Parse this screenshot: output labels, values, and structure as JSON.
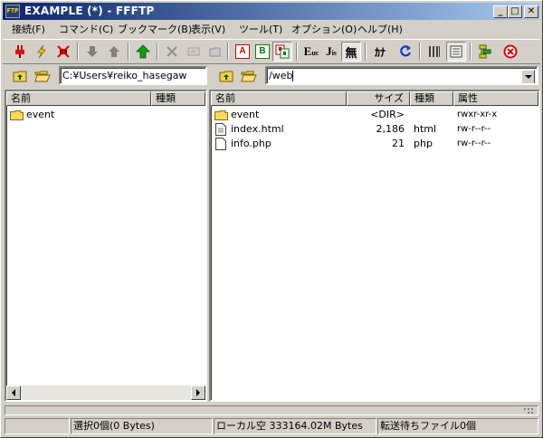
{
  "window": {
    "title": "EXAMPLE (*) - FFFTP"
  },
  "window_buttons": {
    "minimize": "_",
    "maximize": "□",
    "close": "✕"
  },
  "menu": [
    "接続(F)",
    "コマンド(C)",
    "ブックマーク(B)",
    "表示(V)",
    "ツール(T)",
    "オプション(O)",
    "ヘルプ(H)"
  ],
  "toolbar": {
    "ascii_mode": "A",
    "binary_mode": "B",
    "euc": "E",
    "euc_sub": "uc",
    "jis": "J",
    "jis_sub": "is",
    "no_convert": "無",
    "kana": "ｶﾅ"
  },
  "local": {
    "path": "C:¥Users¥reiko_hasegaw",
    "columns": {
      "name": "名前",
      "type": "種類"
    },
    "files": [
      {
        "name": "event",
        "icon": "folder-icon"
      }
    ]
  },
  "remote": {
    "path": "/web",
    "columns": {
      "name": "名前",
      "size": "サイズ",
      "type": "種類",
      "attr": "属性"
    },
    "files": [
      {
        "name": "event",
        "size": "<DIR>",
        "type": "",
        "attr": "rwxr-xr-x",
        "icon": "folder-icon"
      },
      {
        "name": "index.html",
        "size": "2,186",
        "type": "html",
        "attr": "rw-r--r--",
        "icon": "file-icon"
      },
      {
        "name": "info.php",
        "size": "21",
        "type": "php",
        "attr": "rw-r--r--",
        "icon": "file-icon"
      }
    ]
  },
  "status": {
    "selection": "選択0個(0 Bytes)",
    "local_free": "ローカル空 333164.02M Bytes",
    "queue": "転送待ちファイル0個"
  },
  "colors": {
    "titlebar_start": "#0a246a",
    "titlebar_end": "#a6caf0",
    "face": "#d4d0c8"
  }
}
